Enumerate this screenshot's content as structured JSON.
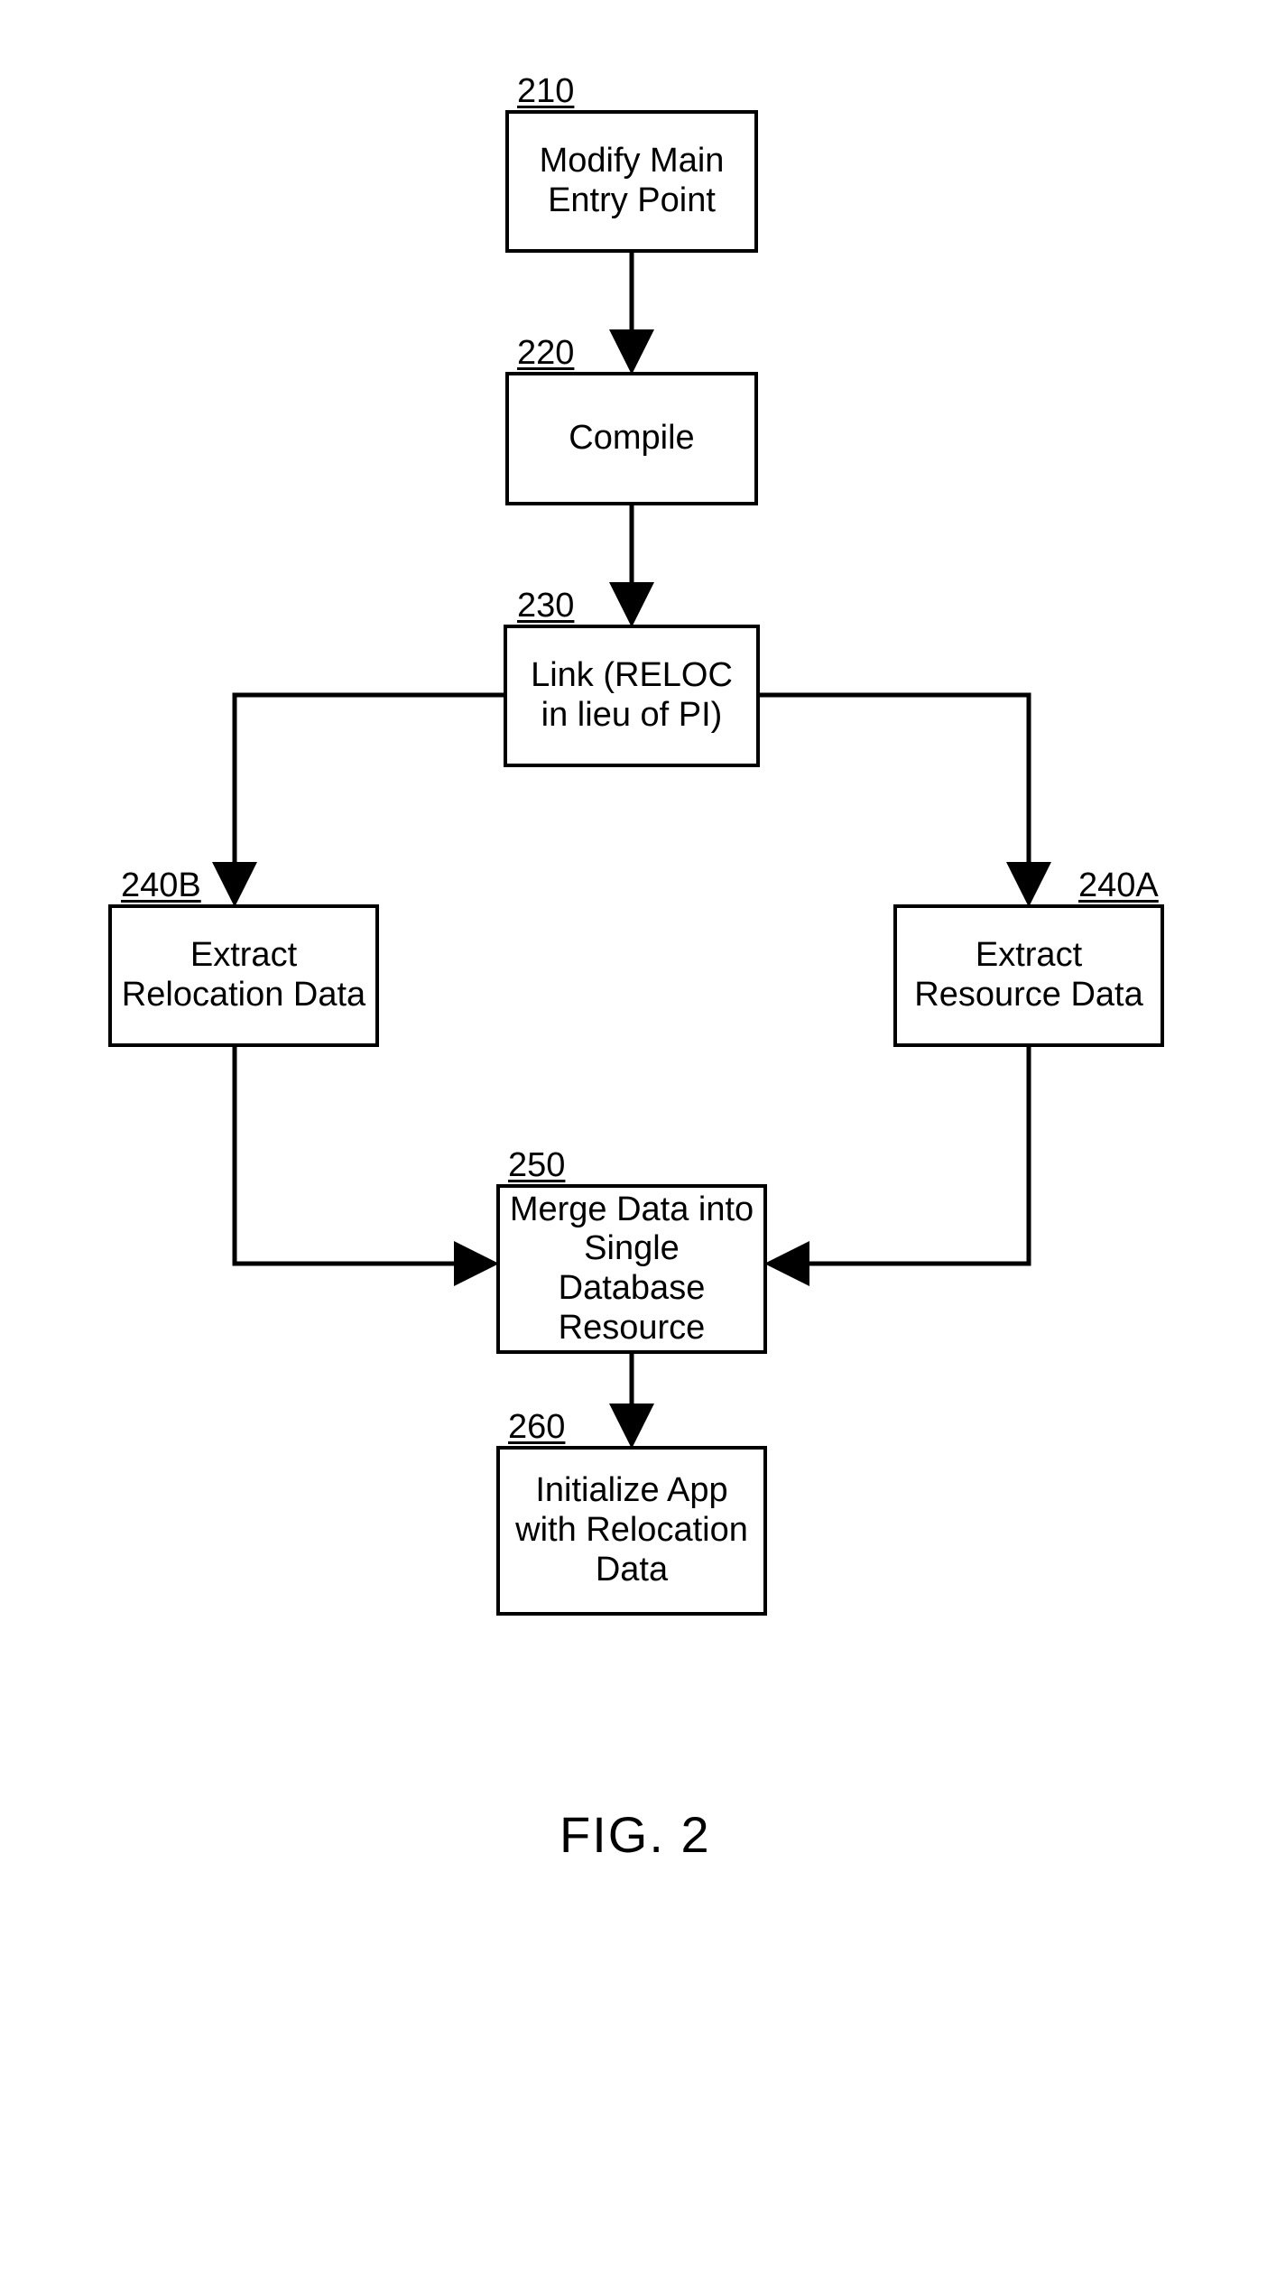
{
  "figure_label": "FIG. 2",
  "nodes": {
    "n210": {
      "tag": "210",
      "text": "Modify Main Entry Point"
    },
    "n220": {
      "tag": "220",
      "text": "Compile"
    },
    "n230": {
      "tag": "230",
      "text": "Link (RELOC in lieu of PI)"
    },
    "n240A": {
      "tag": "240A",
      "text": "Extract Resource Data"
    },
    "n240B": {
      "tag": "240B",
      "text": "Extract Relocation Data"
    },
    "n250": {
      "tag": "250",
      "text": "Merge Data into Single Database Resource"
    },
    "n260": {
      "tag": "260",
      "text": "Initialize  App with Relocation Data"
    }
  },
  "edges": [
    {
      "from": "n210",
      "to": "n220"
    },
    {
      "from": "n220",
      "to": "n230"
    },
    {
      "from": "n230",
      "to": "n240A"
    },
    {
      "from": "n230",
      "to": "n240B"
    },
    {
      "from": "n240A",
      "to": "n250"
    },
    {
      "from": "n240B",
      "to": "n250"
    },
    {
      "from": "n250",
      "to": "n260"
    }
  ]
}
